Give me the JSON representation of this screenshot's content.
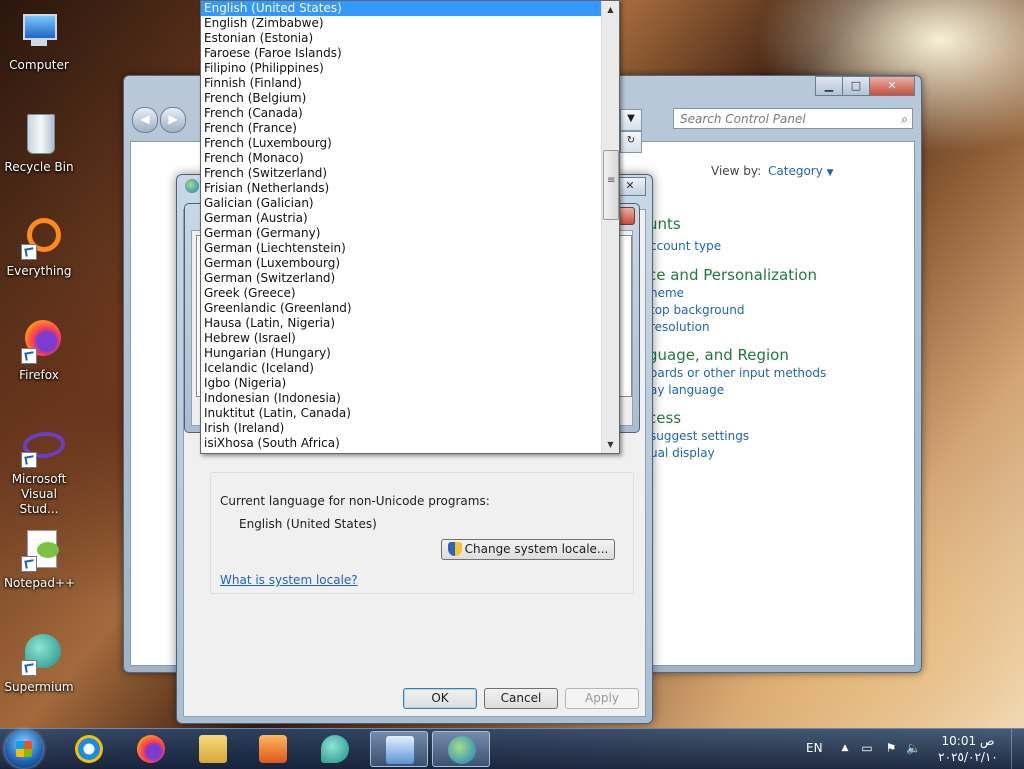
{
  "desktop": {
    "icons": [
      {
        "label": "Computer"
      },
      {
        "label": "Recycle Bin"
      },
      {
        "label": "Everything"
      },
      {
        "label": "Firefox"
      },
      {
        "label": "Microsoft\nVisual Stud..."
      },
      {
        "label": "Notepad++"
      },
      {
        "label": "Supermium"
      }
    ]
  },
  "control_panel": {
    "search_placeholder": "Search Control Panel",
    "view_by_label": "View by:",
    "view_by_value": "Category",
    "categories": [
      {
        "title": "unts",
        "links": [
          "ccount type"
        ]
      },
      {
        "title": "ce and Personalization",
        "links": [
          "heme",
          "top background",
          "resolution"
        ]
      },
      {
        "title": "guage, and Region",
        "links": [
          "oards or other input methods",
          "ay language"
        ]
      },
      {
        "title": "cess",
        "links": [
          "suggest settings",
          "ual display"
        ]
      }
    ]
  },
  "region_dialog": {
    "non_unicode_label": "Current language for non-Unicode programs:",
    "non_unicode_value": "English (United States)",
    "change_locale_button": "Change system locale...",
    "locale_help_link": "What is system locale?",
    "ok_button": "OK",
    "cancel_button": "Cancel",
    "apply_button": "Apply"
  },
  "language_dropdown": {
    "selected": "English (United States)",
    "items": [
      "English (United States)",
      "English (Zimbabwe)",
      "Estonian (Estonia)",
      "Faroese (Faroe Islands)",
      "Filipino (Philippines)",
      "Finnish (Finland)",
      "French (Belgium)",
      "French (Canada)",
      "French (France)",
      "French (Luxembourg)",
      "French (Monaco)",
      "French (Switzerland)",
      "Frisian (Netherlands)",
      "Galician (Galician)",
      "German (Austria)",
      "German (Germany)",
      "German (Liechtenstein)",
      "German (Luxembourg)",
      "German (Switzerland)",
      "Greek (Greece)",
      "Greenlandic (Greenland)",
      "Hausa (Latin, Nigeria)",
      "Hebrew (Israel)",
      "Hungarian (Hungary)",
      "Icelandic (Iceland)",
      "Igbo (Nigeria)",
      "Indonesian (Indonesia)",
      "Inuktitut (Latin, Canada)",
      "Irish (Ireland)",
      "isiXhosa (South Africa)"
    ]
  },
  "taskbar": {
    "apps": [
      "internet-explorer",
      "firefox",
      "file-explorer",
      "media-player",
      "supermium",
      "control-panel",
      "region-settings"
    ],
    "language_indicator": "EN",
    "clock_time": "ص 10:01",
    "clock_date": "٢٠٢٥/٠٢/١٠"
  },
  "colors": {
    "selection": "#3399ff",
    "link": "#1f64b8",
    "category_green": "#1e7a3c"
  }
}
